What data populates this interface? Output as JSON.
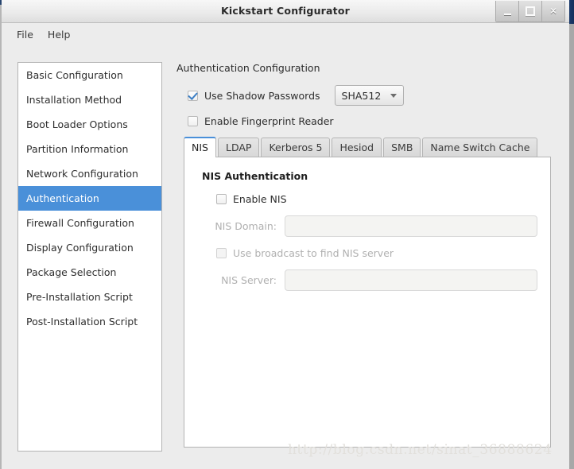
{
  "window": {
    "title": "Kickstart Configurator",
    "buttons": [
      {
        "name": "minimize",
        "label": "–"
      },
      {
        "name": "maximize",
        "label": "□"
      },
      {
        "name": "close",
        "label": "✕"
      }
    ]
  },
  "menubar": {
    "items": [
      {
        "label": "File"
      },
      {
        "label": "Help"
      }
    ]
  },
  "sidebar": {
    "items": [
      {
        "label": "Basic Configuration",
        "selected": false
      },
      {
        "label": "Installation Method",
        "selected": false
      },
      {
        "label": "Boot Loader Options",
        "selected": false
      },
      {
        "label": "Partition Information",
        "selected": false
      },
      {
        "label": "Network Configuration",
        "selected": false
      },
      {
        "label": "Authentication",
        "selected": true
      },
      {
        "label": "Firewall Configuration",
        "selected": false
      },
      {
        "label": "Display Configuration",
        "selected": false
      },
      {
        "label": "Package Selection",
        "selected": false
      },
      {
        "label": "Pre-Installation Script",
        "selected": false
      },
      {
        "label": "Post-Installation Script",
        "selected": false
      }
    ],
    "selected_index": 5,
    "selection_color": "#4a90d9"
  },
  "panel": {
    "title": "Authentication Configuration",
    "shadow_passwords": {
      "label": "Use Shadow Passwords",
      "checked": true
    },
    "hash_select": {
      "value": "SHA512",
      "arrow_icon": "chevron-down-icon"
    },
    "fingerprint_reader": {
      "label": "Enable Fingerprint Reader",
      "checked": false
    },
    "tabs": [
      {
        "label": "NIS",
        "active": true
      },
      {
        "label": "LDAP",
        "active": false
      },
      {
        "label": "Kerberos 5",
        "active": false
      },
      {
        "label": "Hesiod",
        "active": false
      },
      {
        "label": "SMB",
        "active": false
      },
      {
        "label": "Name Switch Cache",
        "active": false
      }
    ],
    "active_tab": "NIS",
    "nis": {
      "title": "NIS Authentication",
      "enable": {
        "label": "Enable NIS",
        "checked": false,
        "disabled": false
      },
      "domain": {
        "label": "NIS Domain:",
        "value": "",
        "placeholder": "",
        "disabled": true
      },
      "broadcast": {
        "label": "Use broadcast to find NIS server",
        "checked": false,
        "disabled": true
      },
      "server": {
        "label": "NIS Server:",
        "value": "",
        "placeholder": "",
        "disabled": true
      }
    }
  },
  "watermark": {
    "text": "http://blog.csdn.net/sinat_36888624"
  }
}
